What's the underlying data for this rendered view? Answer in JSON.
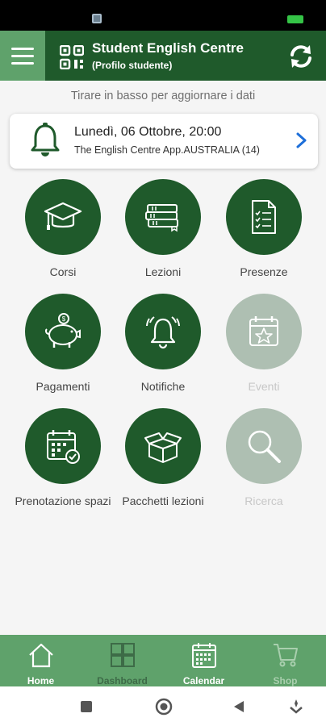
{
  "header": {
    "title": "Student English Centre",
    "subtitle": "(Profilo studente)",
    "menu_icon": "hamburger-icon",
    "qr_icon": "qr-code-icon",
    "refresh_icon": "refresh-icon",
    "bg_color": "#1f5a2b",
    "accent_color": "#5fa26b"
  },
  "pull_hint": "Tirare in basso per aggiornare i dati",
  "notice": {
    "date": "Lunedì, 06 Ottobre, 20:00",
    "source": "The English Centre App.AUSTRALIA (14)",
    "icon": "bell-icon"
  },
  "tiles": [
    {
      "label": "Corsi",
      "icon": "graduation-cap-icon",
      "enabled": true
    },
    {
      "label": "Lezioni",
      "icon": "books-icon",
      "enabled": true
    },
    {
      "label": "Presenze",
      "icon": "checklist-icon",
      "enabled": true
    },
    {
      "label": "Pagamenti",
      "icon": "piggy-bank-icon",
      "enabled": true
    },
    {
      "label": "Notifiche",
      "icon": "bell-icon",
      "enabled": true
    },
    {
      "label": "Eventi",
      "icon": "calendar-star-icon",
      "enabled": false
    },
    {
      "label": "Prenotazione spazi",
      "icon": "calendar-check-icon",
      "enabled": true
    },
    {
      "label": "Pacchetti lezioni",
      "icon": "package-icon",
      "enabled": true
    },
    {
      "label": "Ricerca",
      "icon": "search-icon",
      "enabled": false
    }
  ],
  "bottom_nav": [
    {
      "label": "Home",
      "icon": "home-icon"
    },
    {
      "label": "Dashboard",
      "icon": "dashboard-icon"
    },
    {
      "label": "Calendar",
      "icon": "calendar-icon"
    },
    {
      "label": "Shop",
      "icon": "cart-icon"
    }
  ],
  "system_nav": [
    "recents-icon",
    "home-circle-icon",
    "back-icon",
    "assistant-icon"
  ]
}
